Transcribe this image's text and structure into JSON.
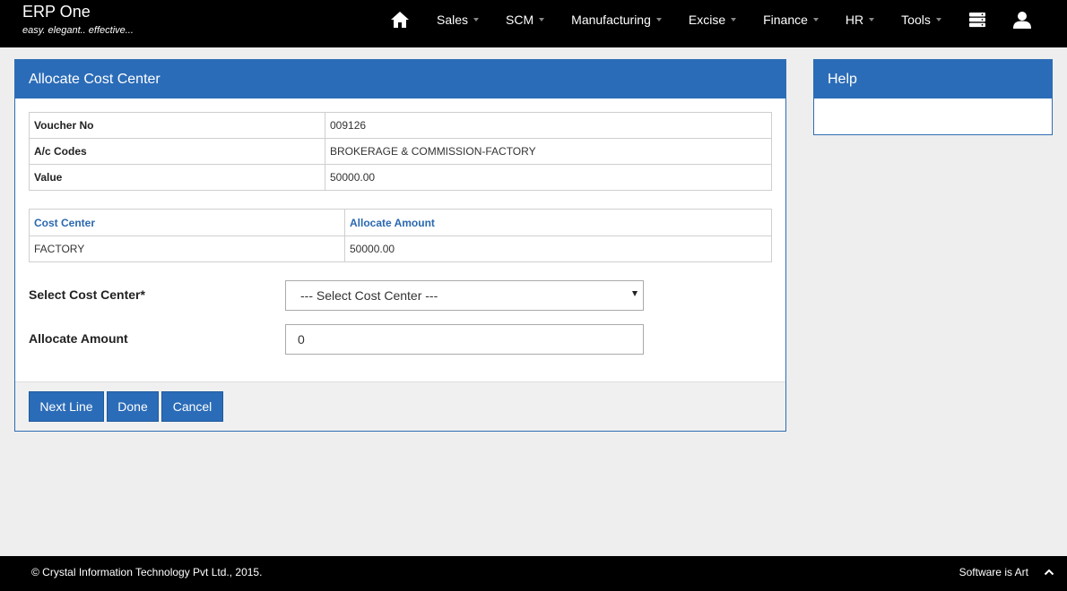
{
  "brand": {
    "name": "ERP One",
    "tagline": "easy. elegant.. effective..."
  },
  "nav": {
    "home_icon": "home-icon",
    "items": [
      {
        "label": "Sales"
      },
      {
        "label": "SCM"
      },
      {
        "label": "Manufacturing"
      },
      {
        "label": "Excise"
      },
      {
        "label": "Finance"
      },
      {
        "label": "HR"
      },
      {
        "label": "Tools"
      }
    ],
    "right_icons": [
      "server-icon",
      "user-icon"
    ]
  },
  "panel": {
    "title": "Allocate Cost Center",
    "info": [
      {
        "key": "Voucher No",
        "value": "009126"
      },
      {
        "key": "A/c Codes",
        "value": "BROKERAGE & COMMISSION-FACTORY"
      },
      {
        "key": "Value",
        "value": "50000.00"
      }
    ],
    "alloc_table": {
      "headers": [
        "Cost Center",
        "Allocate Amount"
      ],
      "rows": [
        [
          "FACTORY",
          "50000.00"
        ]
      ]
    },
    "form": {
      "cost_center_label": "Select Cost Center*",
      "cost_center_value": "--- Select Cost Center ---",
      "amount_label": "Allocate Amount",
      "amount_value": "0"
    },
    "buttons": {
      "next_line": "Next Line",
      "done": "Done",
      "cancel": "Cancel"
    }
  },
  "help": {
    "title": "Help"
  },
  "footer": {
    "copyright": "© Crystal Information Technology Pvt Ltd., 2015.",
    "motto": "Software is Art"
  },
  "colors": {
    "primary": "#2b6cb8",
    "navbar": "#000000",
    "background": "#eeeeee"
  }
}
